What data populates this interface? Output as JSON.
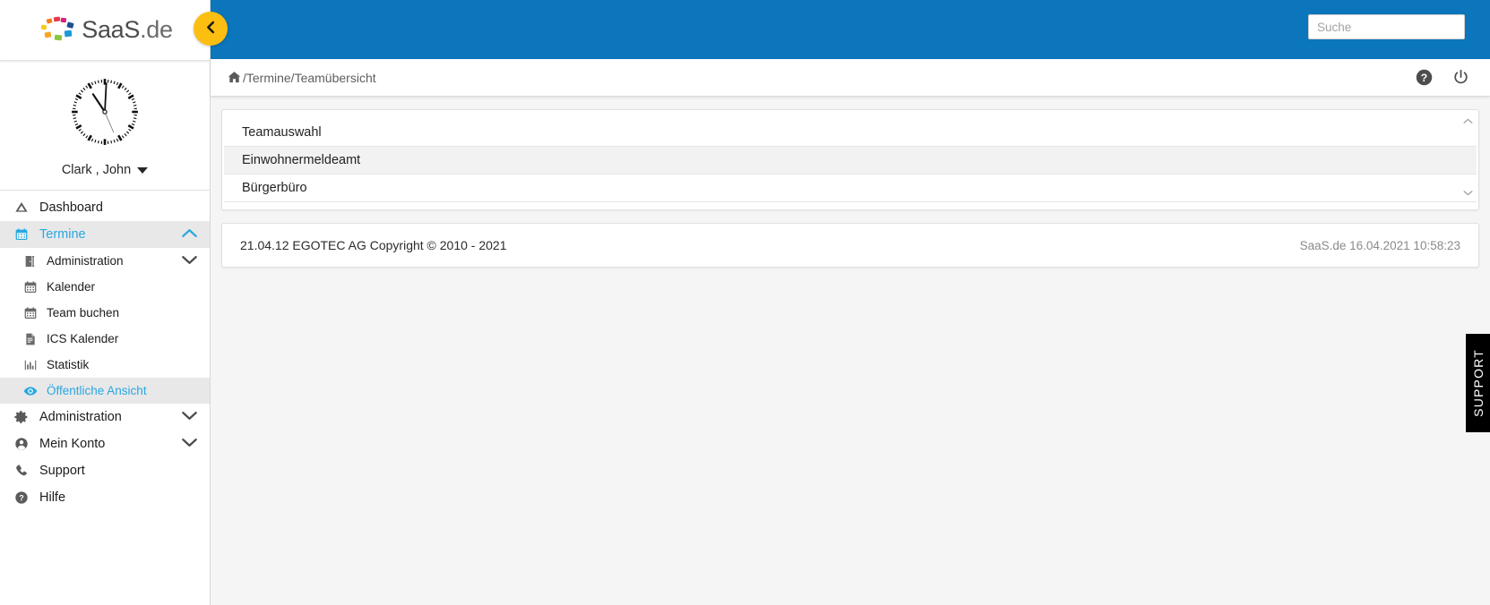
{
  "brand": {
    "name": "SaaS",
    "tld": ".de",
    "accent_blue": "#0b76bc",
    "accent_yellow": "#fcbe11",
    "link_blue": "#29a8e0"
  },
  "topbar": {
    "search_placeholder": "Suche",
    "search_value": "",
    "collapse_label": "‹"
  },
  "profile": {
    "name": "Clark , John",
    "clock_time": "10:58:23"
  },
  "breadcrumb": {
    "home_icon": "home-icon",
    "path": "/Termine/Teamübersicht"
  },
  "crumb_actions": [
    {
      "name": "help-icon",
      "label": "?"
    },
    {
      "name": "power-icon",
      "label": "⏻"
    }
  ],
  "sidebar": {
    "items": [
      {
        "label": "Dashboard",
        "icon": "dashboard-icon",
        "level": 0,
        "active": false,
        "chevron": ""
      },
      {
        "label": "Termine",
        "icon": "calendar-icon",
        "level": 0,
        "active": true,
        "chevron": "up"
      },
      {
        "label": "Administration",
        "icon": "door-icon",
        "level": 1,
        "active": false,
        "chevron": "down"
      },
      {
        "label": "Kalender",
        "icon": "calendar-icon",
        "level": 1,
        "active": false,
        "chevron": ""
      },
      {
        "label": "Team buchen",
        "icon": "calendar-icon",
        "level": 1,
        "active": false,
        "chevron": ""
      },
      {
        "label": "ICS Kalender",
        "icon": "file-icon",
        "level": 1,
        "active": false,
        "chevron": ""
      },
      {
        "label": "Statistik",
        "icon": "chart-bar-icon",
        "level": 1,
        "active": false,
        "chevron": ""
      },
      {
        "label": "Öffentliche Ansicht",
        "icon": "eye-icon",
        "level": 1,
        "active": true,
        "chevron": ""
      },
      {
        "label": "Administration",
        "icon": "gear-icon",
        "level": 0,
        "active": false,
        "chevron": "down"
      },
      {
        "label": "Mein Konto",
        "icon": "user-circle-icon",
        "level": 0,
        "active": false,
        "chevron": "down"
      },
      {
        "label": "Support",
        "icon": "phone-icon",
        "level": 0,
        "active": false,
        "chevron": ""
      },
      {
        "label": "Hilfe",
        "icon": "help-circle-icon",
        "level": 0,
        "active": false,
        "chevron": ""
      }
    ]
  },
  "team_panel": {
    "header": "Teamauswahl",
    "rows": [
      {
        "label": "Einwohnermeldeamt",
        "selected": true
      },
      {
        "label": "Bürgerbüro",
        "selected": false
      }
    ],
    "scroll_up": "⌃",
    "scroll_down": "⌄"
  },
  "footer": {
    "left": "21.04.12 EGOTEC AG Copyright © 2010 - 2021",
    "right": "SaaS.de  16.04.2021 10:58:23"
  },
  "support_tab": {
    "label": "SUPPORT"
  }
}
